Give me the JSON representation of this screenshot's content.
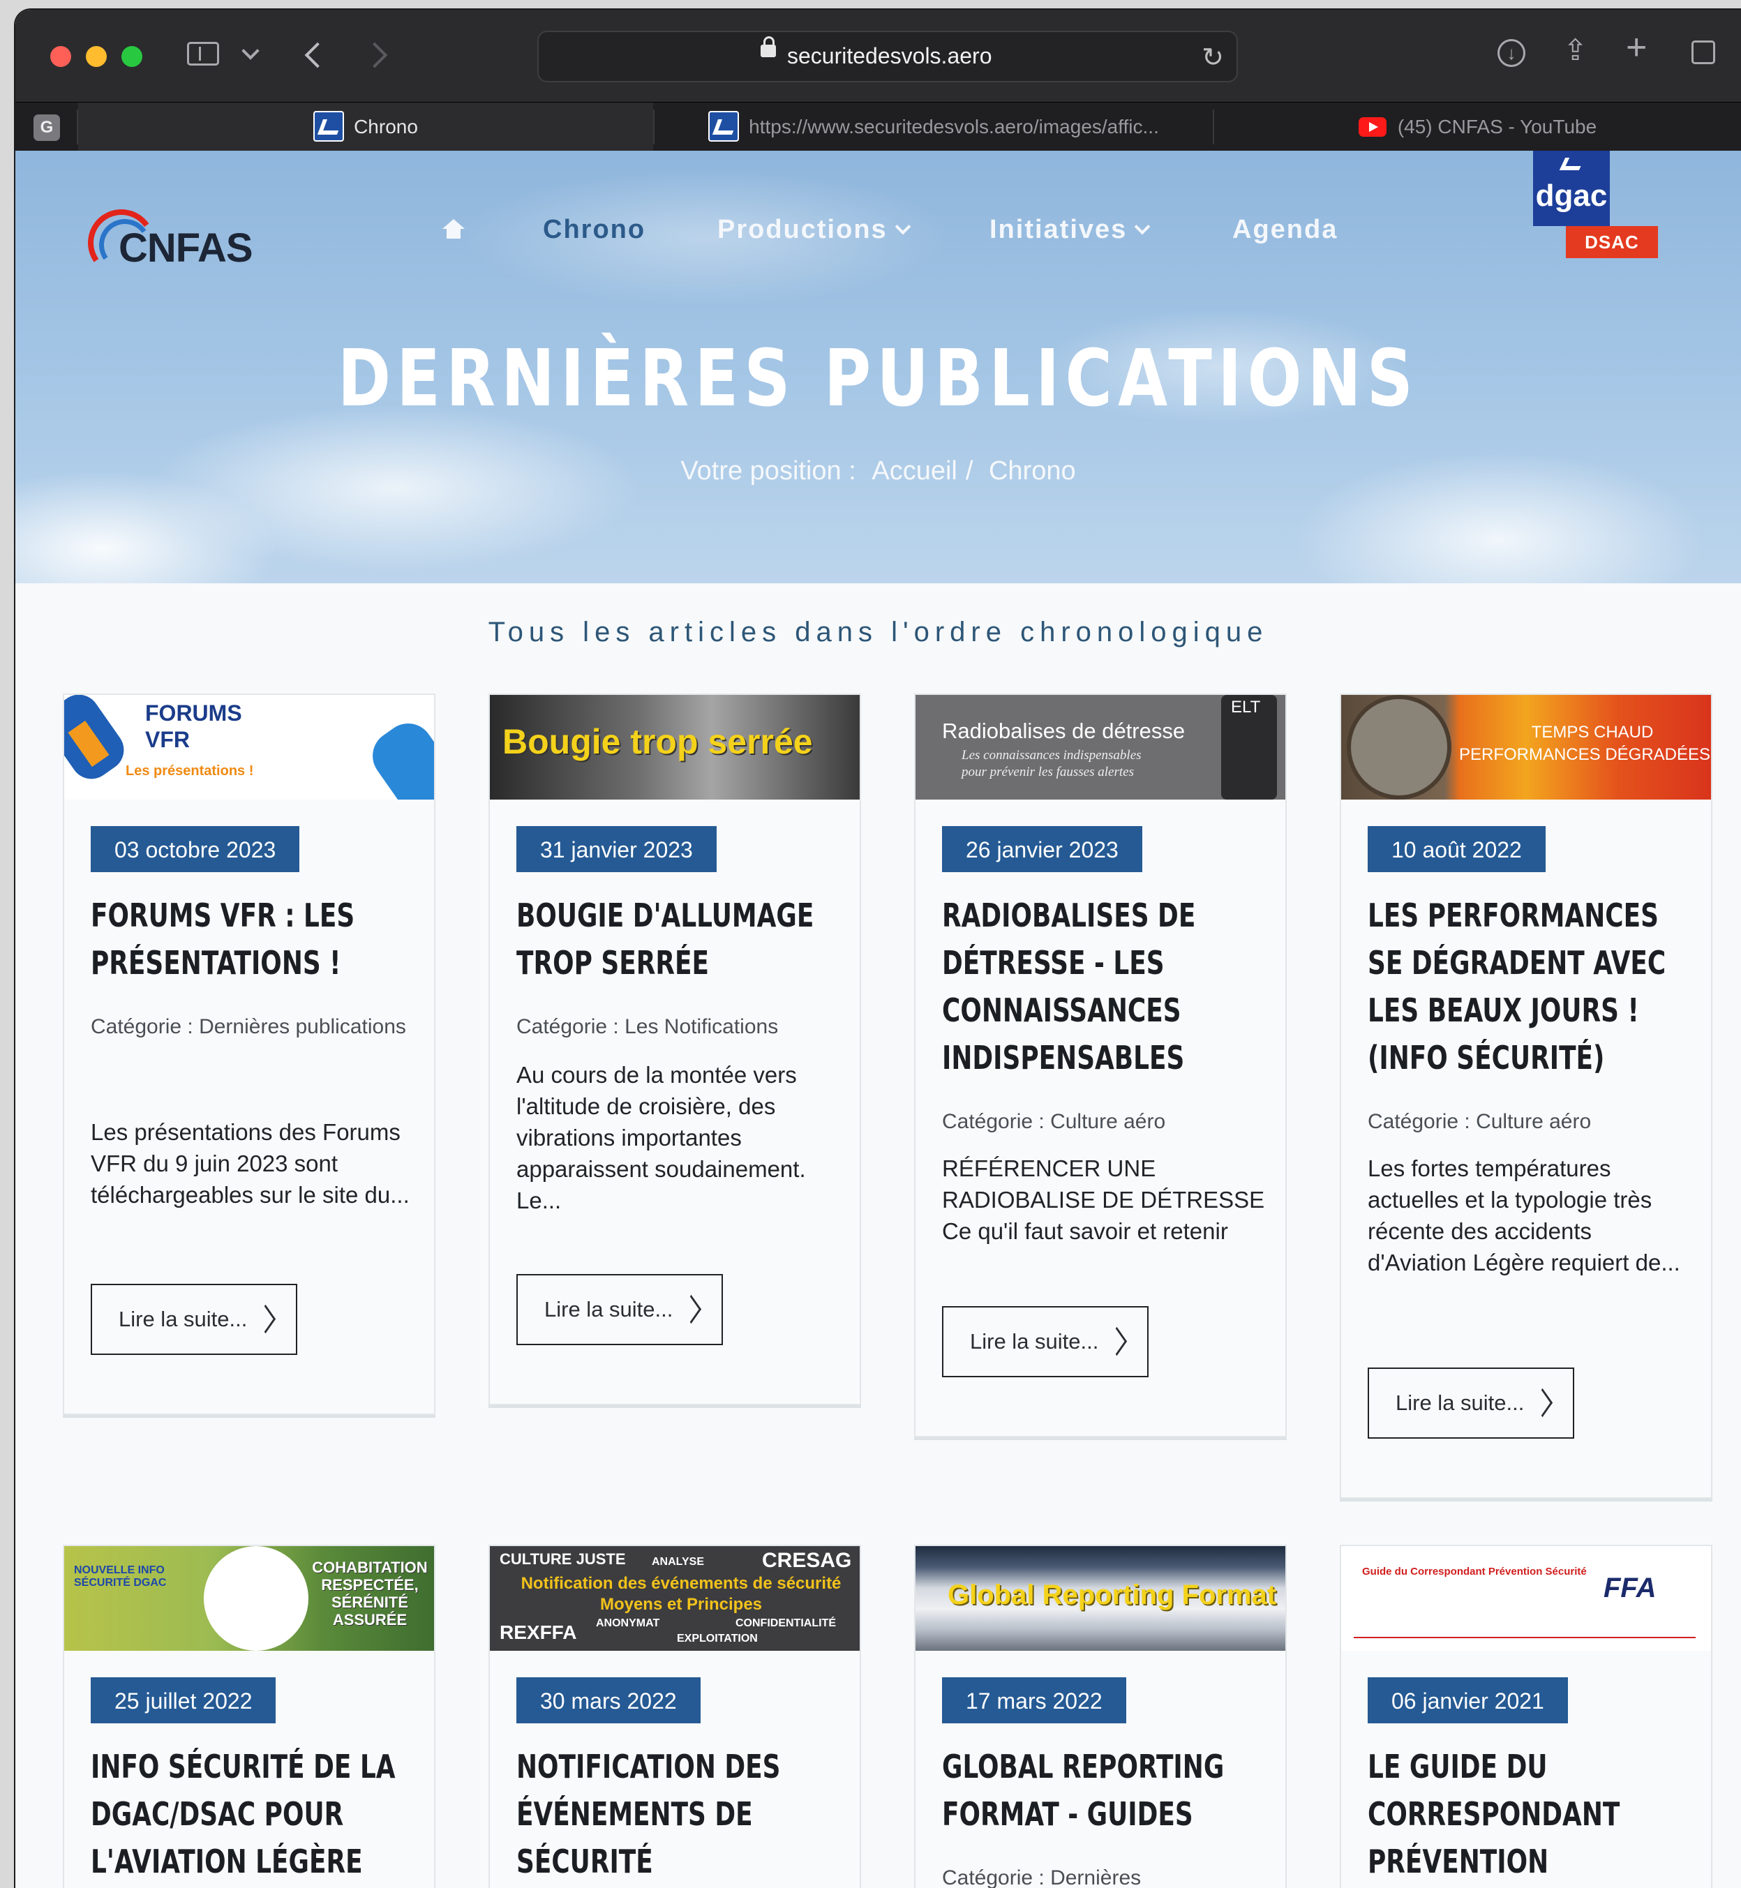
{
  "browser": {
    "url": "securitedesvols.aero",
    "tabs": [
      {
        "label": "Chrono"
      },
      {
        "label": "https://www.securitedesvols.aero/images/affic..."
      },
      {
        "label": "(45) CNFAS - YouTube"
      }
    ],
    "group_badge": "G"
  },
  "site": {
    "logo": "CNFAS",
    "nav": {
      "chrono": "Chrono",
      "productions": "Productions",
      "initiatives": "Initiatives",
      "agenda": "Agenda"
    },
    "dgac": "dgac",
    "dsac": "DSAC"
  },
  "hero": {
    "title": "DERNIÈRES PUBLICATIONS",
    "crumb_prefix": "Votre position :",
    "crumb_home": "Accueil",
    "crumb_sep": "/",
    "crumb_current": "Chrono"
  },
  "subheading": "Tous les articles dans l'ordre chronologique",
  "read_more": "Lire la suite...",
  "articles": [
    {
      "date": "03 octobre 2023",
      "title": "FORUMS VFR : LES PRÉSENTATIONS !",
      "category": "Catégorie : Dernières publications",
      "excerpt": "Les présentations des Forums VFR du 9 juin 2023 sont téléchargeables sur le site du...",
      "thumb": {
        "l1": "FORUMS",
        "l2": "VFR",
        "l3": "Les présentations !"
      }
    },
    {
      "date": "31 janvier 2023",
      "title": "BOUGIE D'ALLUMAGE TROP SERRÉE",
      "category": "Catégorie : Les Notifications",
      "excerpt": "Au cours de la montée vers l'altitude de croisière, des vibrations importantes apparaissent soudainement. Le...",
      "thumb": {
        "l1": "Bougie trop serrée"
      }
    },
    {
      "date": "26 janvier 2023",
      "title": "RADIOBALISES DE DÉTRESSE - LES CONNAISSANCES INDISPENSABLES",
      "category": "Catégorie : Culture aéro",
      "excerpt": " RÉFÉRENCER UNE RADIOBALISE DE DÉTRESSE Ce qu'il faut savoir et retenir",
      "thumb": {
        "l1": "Radiobalises de détresse",
        "l2": "Les connaissances indispensables",
        "l3": "pour prévenir les fausses alertes",
        "l4": "ELT"
      }
    },
    {
      "date": "10 août 2022",
      "title": "LES PERFORMANCES SE DÉGRADENT AVEC LES BEAUX JOURS ! (INFO SÉCURITÉ)",
      "category": "Catégorie : Culture aéro",
      "excerpt": " Les fortes températures actuelles et la typologie très récente des accidents d'Aviation Légère requiert de...",
      "thumb": {
        "l1": "TEMPS CHAUD",
        "l2": "PERFORMANCES DÉGRADÉES"
      }
    },
    {
      "date": "25 juillet 2022",
      "title": "INFO SÉCURITÉ DE LA DGAC/DSAC POUR L'AVIATION LÉGÈRE",
      "category": "",
      "excerpt": "",
      "thumb": {
        "l1": "NOUVELLE INFO SÉCURITÉ DGAC",
        "l2": "COHABITATION RESPECTÉE, SÉRÉNITÉ ASSURÉE"
      }
    },
    {
      "date": "30 mars 2022",
      "title": "NOTIFICATION DES ÉVÉNEMENTS DE SÉCURITÉ",
      "category": "",
      "excerpt": "",
      "thumb": {
        "l1": "CULTURE JUSTE",
        "l2": "ANALYSE",
        "l3": "CRESAG",
        "l4": "Notification des événements de sécurité",
        "l5": "Moyens et Principes",
        "l6": "REXFFA",
        "l7": "ANONYMAT",
        "l8": "CONFIDENTIALITÉ",
        "l9": "EXPLOITATION"
      }
    },
    {
      "date": "17 mars 2022",
      "title": "GLOBAL REPORTING FORMAT - GUIDES",
      "category": "Catégorie : Dernières",
      "excerpt": "",
      "thumb": {
        "l1": "Global Reporting Format"
      }
    },
    {
      "date": "06 janvier 2021",
      "title": "LE GUIDE DU CORRESPONDANT PRÉVENTION SÉCURITÉ",
      "category": "",
      "excerpt": "",
      "thumb": {
        "l1": "Guide du Correspondant Prévention Sécurité",
        "l2": "FFA"
      }
    }
  ],
  "colors": {
    "accent": "#255a94",
    "hero_sky": "#a6c7e6",
    "toolbar": "#2b2b2d"
  }
}
